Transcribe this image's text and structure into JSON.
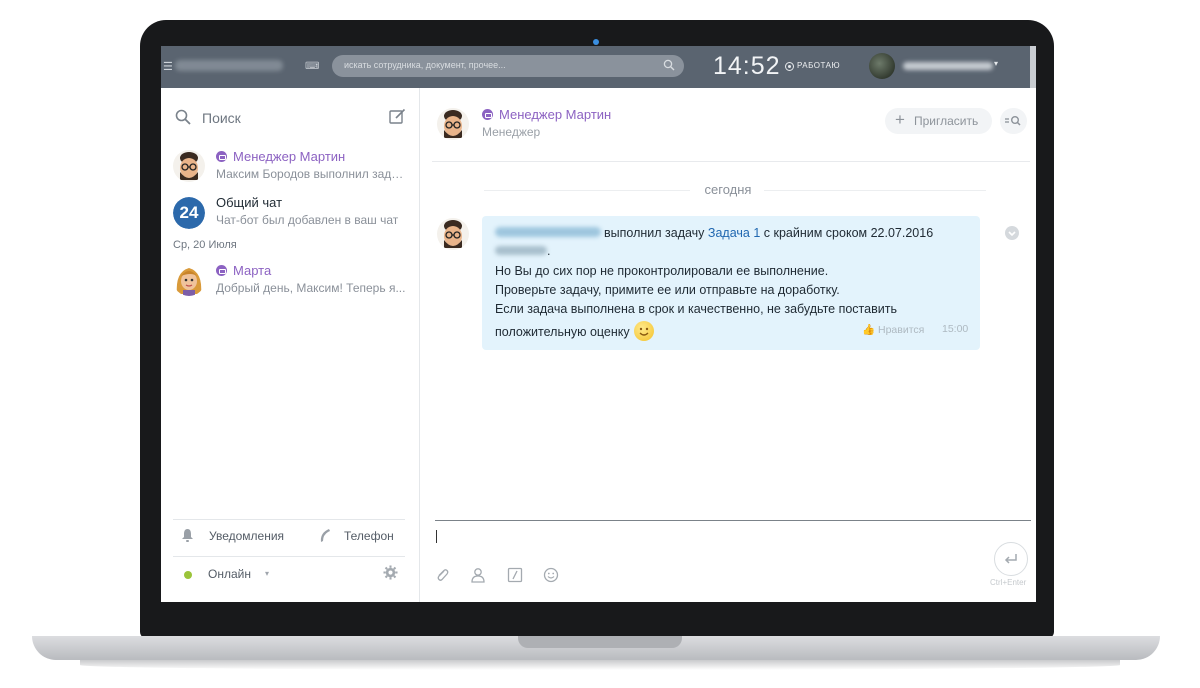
{
  "topbar": {
    "search_placeholder": "искать сотрудника, документ, прочее...",
    "clock": "14:52",
    "work_status": "РАБОТАЮ"
  },
  "sidebar": {
    "search_label": "Поиск",
    "chats": [
      {
        "title": "Менеджер Мартин",
        "subtitle": "Максим Бородов выполнил задачу...",
        "type": "bot"
      },
      {
        "title": "Общий чат",
        "subtitle": "Чат-бот был добавлен в ваш чат",
        "type": "general",
        "badge": "24"
      }
    ],
    "date_separator": "Ср, 20 Июля",
    "chats_older": [
      {
        "title": "Марта",
        "subtitle": "Добрый день, Максим! Теперь я...",
        "type": "bot"
      }
    ],
    "notifications_label": "Уведомления",
    "phone_label": "Телефон",
    "status_label": "Онлайн"
  },
  "chat": {
    "header_title": "Менеджер Мартин",
    "header_subtitle": "Менеджер",
    "invite_label": "Пригласить",
    "date_divider": "сегодня",
    "message": {
      "line1_text": "выполнил задачу",
      "task_link": "Задача 1",
      "line1_tail": "с крайним сроком 22.07.2016",
      "line2_tail": ".",
      "line3": "Но Вы до сих пор не проконтролировали ее выполнение.",
      "line4": "Проверьте задачу, примите ее или отправьте на доработку.",
      "line5": "Если задача выполнена в срок и качественно, не забудьте поставить",
      "line6": "положительную оценку",
      "like_label": "Нравится",
      "time": "15:00"
    },
    "send_hint": "Ctrl+Enter"
  },
  "colors": {
    "accent_purple": "#8c62c2",
    "link_blue": "#2067b0",
    "bubble_bg": "#e3f3fc",
    "topbar_bg": "#5a6470",
    "online_green": "#9bc43a"
  }
}
